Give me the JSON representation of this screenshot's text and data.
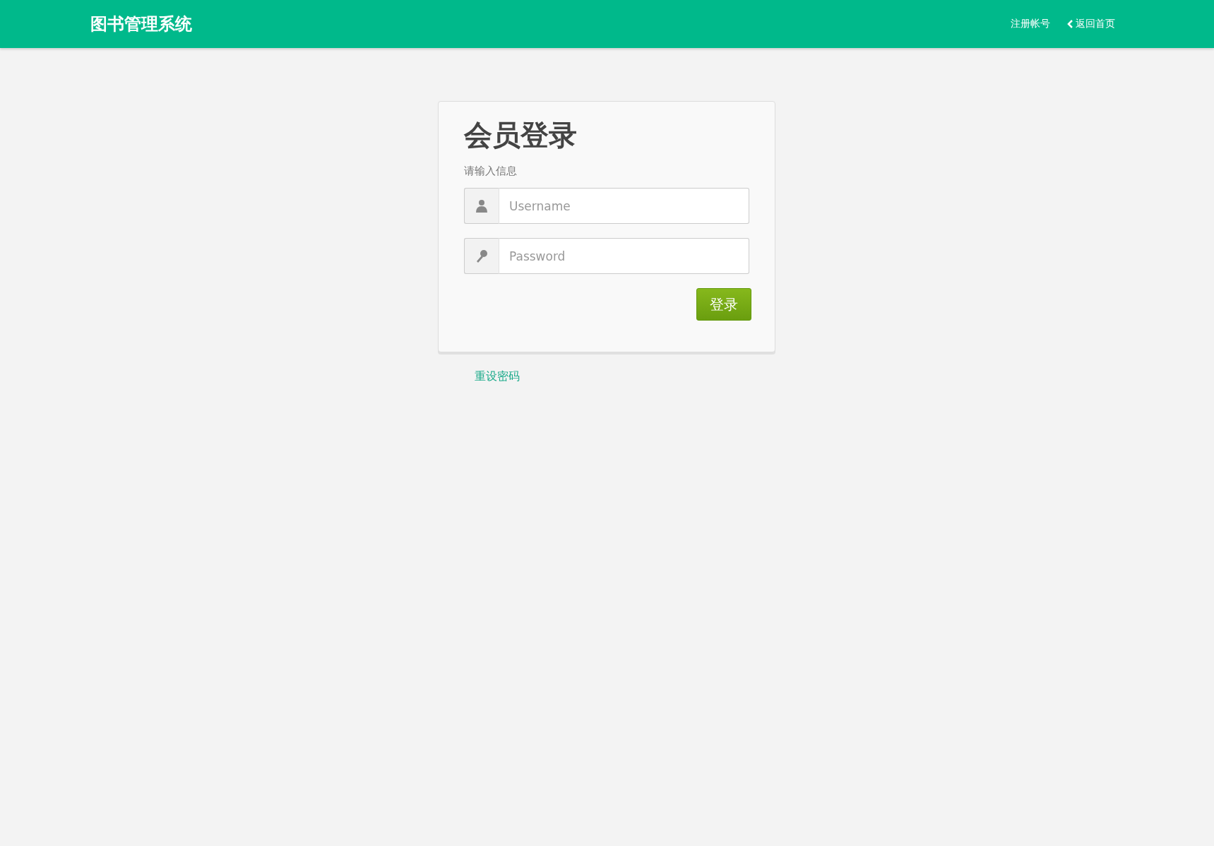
{
  "header": {
    "brand": "图书管理系统",
    "links": [
      {
        "kind": "plain",
        "label": "注册帐号"
      },
      {
        "kind": "back",
        "label": "返回首页"
      }
    ]
  },
  "login": {
    "title": "会员登录",
    "subtitle": "请输入信息",
    "fields": [
      {
        "kind": "user",
        "placeholder": "Username"
      },
      {
        "kind": "key",
        "placeholder": "Password"
      }
    ],
    "submit": "登录"
  },
  "reset_link": "重设密码"
}
